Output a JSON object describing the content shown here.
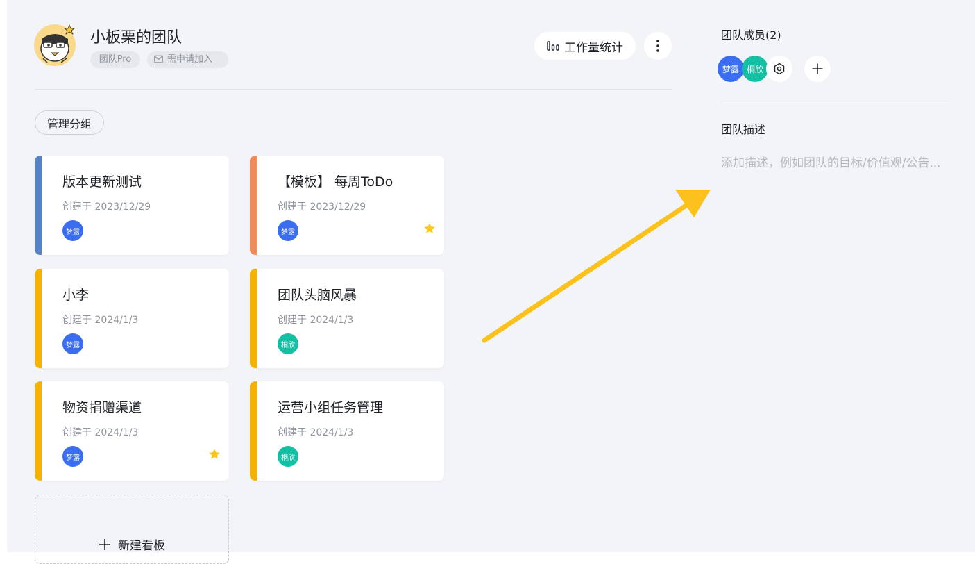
{
  "team": {
    "name": "小板栗的团队",
    "plan_tag": "团队Pro",
    "join_tag": "需申请加入"
  },
  "toolbar": {
    "stats_label": "工作量统计",
    "more_icon": "more-vertical-icon"
  },
  "manage_group_label": "管理分组",
  "boards": [
    {
      "title": "版本更新测试",
      "date": "创建于 2023/12/29",
      "accent": "#5484c5",
      "member": "梦露",
      "member_color": "#3a6df0",
      "starred": false
    },
    {
      "title": "【模板】 每周ToDo",
      "date": "创建于 2023/12/29",
      "accent": "#f28b5a",
      "member": "梦露",
      "member_color": "#3a6df0",
      "starred": true
    },
    {
      "title": "小李",
      "date": "创建于 2024/1/3",
      "accent": "#f5b300",
      "member": "梦露",
      "member_color": "#3a6df0",
      "starred": false
    },
    {
      "title": "团队头脑风暴",
      "date": "创建于 2024/1/3",
      "accent": "#f5b300",
      "member": "桐欣",
      "member_color": "#14c0a4",
      "starred": false
    },
    {
      "title": "物资捐赠渠道",
      "date": "创建于 2024/1/3",
      "accent": "#f5b300",
      "member": "梦露",
      "member_color": "#3a6df0",
      "starred": true
    },
    {
      "title": "运营小组任务管理",
      "date": "创建于 2024/1/3",
      "accent": "#f5b300",
      "member": "桐欣",
      "member_color": "#14c0a4",
      "starred": false
    }
  ],
  "new_board_label": "新建看板",
  "members": {
    "title": "团队成员(2)",
    "list": [
      {
        "name": "梦露",
        "color": "#3a6df0"
      },
      {
        "name": "桐欣",
        "color": "#14c0a4"
      }
    ]
  },
  "description": {
    "title": "团队描述",
    "placeholder": "添加描述，例如团队的目标/价值观/公告..."
  },
  "colors": {
    "star": "#fbc51a",
    "annotation_arrow": "#fcc21b",
    "background": "#f3f4f7"
  }
}
